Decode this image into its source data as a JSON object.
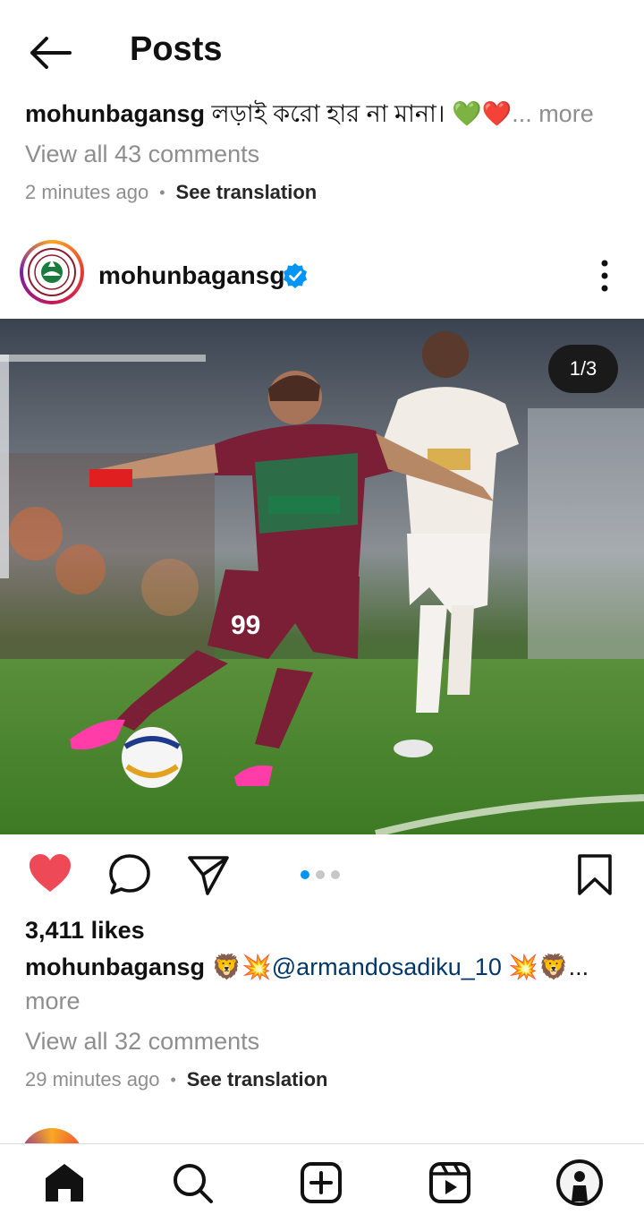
{
  "header": {
    "title": "Posts",
    "back_icon": "arrow-left-icon"
  },
  "previous_post": {
    "username": "mohunbagansg",
    "caption": "লড়াই করো হার না মানা। 💚❤️",
    "more_label": "... more",
    "comments_link": "View all 43 comments",
    "time": "2 minutes ago",
    "translate": "See translation"
  },
  "post": {
    "username": "mohunbagansg",
    "verified": true,
    "avatar_ring": [
      "#f9a825",
      "#e53935",
      "#c2185b",
      "#7b1fa2"
    ],
    "photo_counter": "1/3",
    "carousel": {
      "count": 3,
      "active": 1
    },
    "like_color": "#ed4956",
    "jersey_number": "99",
    "likes": "3,411 likes",
    "caption_user": "mohunbagansg",
    "caption_emoji_pre": "🦁💥",
    "caption_mention": "@armandosadiku_10",
    "caption_emoji_post": " 💥🦁...",
    "more_label": "more",
    "comments_link": "View all 32 comments",
    "time": "29 minutes ago",
    "translate": "See translation"
  },
  "navbar": {
    "items": [
      "home-icon",
      "search-icon",
      "create-icon",
      "reels-icon",
      "profile-avatar"
    ]
  }
}
